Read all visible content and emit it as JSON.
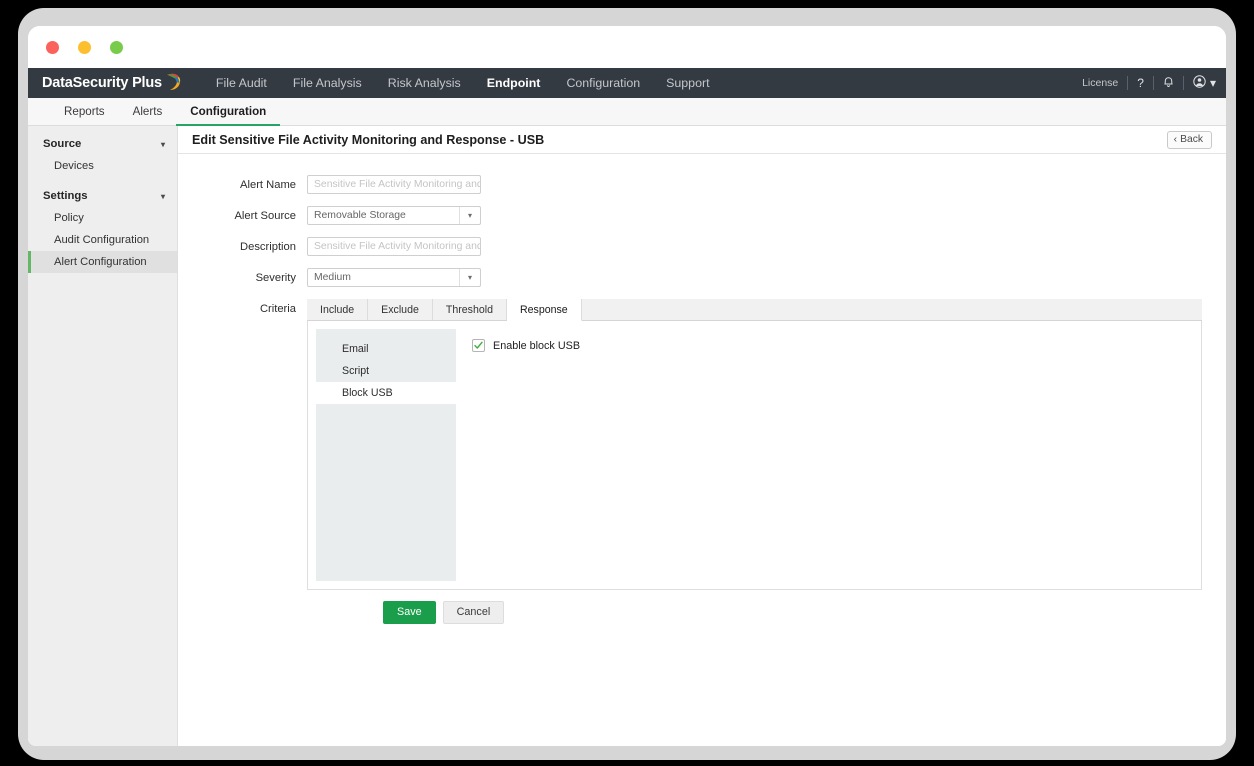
{
  "window": {
    "traffic_lights": [
      "close",
      "minimize",
      "maximize"
    ]
  },
  "topnav": {
    "brand": "DataSecurity Plus",
    "items": [
      {
        "label": "File Audit",
        "active": false
      },
      {
        "label": "File Analysis",
        "active": false
      },
      {
        "label": "Risk Analysis",
        "active": false
      },
      {
        "label": "Endpoint",
        "active": true
      },
      {
        "label": "Configuration",
        "active": false
      },
      {
        "label": "Support",
        "active": false
      }
    ],
    "right": {
      "license": "License",
      "help": "?",
      "notifications_icon": "bell-icon",
      "account_icon": "user-circle-icon",
      "account_caret": "▾"
    }
  },
  "subnav": {
    "items": [
      {
        "label": "Reports",
        "active": false
      },
      {
        "label": "Alerts",
        "active": false
      },
      {
        "label": "Configuration",
        "active": true
      }
    ]
  },
  "sidebar": {
    "groups": [
      {
        "label": "Source",
        "caret": "▾",
        "items": [
          {
            "label": "Devices",
            "selected": false
          }
        ]
      },
      {
        "label": "Settings",
        "caret": "▾",
        "items": [
          {
            "label": "Policy",
            "selected": false
          },
          {
            "label": "Audit Configuration",
            "selected": false
          },
          {
            "label": "Alert Configuration",
            "selected": true
          }
        ]
      }
    ]
  },
  "page": {
    "title": "Edit Sensitive File Activity Monitoring and Response - USB",
    "back_label": "Back",
    "back_icon": "chevron-left-icon"
  },
  "form": {
    "alert_name": {
      "label": "Alert Name",
      "value": "Sensitive File Activity Monitoring and Resp",
      "placeholder": "Sensitive File Activity Monitoring and Resp"
    },
    "alert_source": {
      "label": "Alert Source",
      "value": "Removable Storage",
      "options": [
        "Removable Storage"
      ],
      "caret_icon": "chevron-down-icon"
    },
    "description": {
      "label": "Description",
      "value": "Sensitive File Activity Monitoring and Resp",
      "placeholder": "Sensitive File Activity Monitoring and Resp"
    },
    "severity": {
      "label": "Severity",
      "value": "Medium",
      "options": [
        "Medium"
      ],
      "caret_icon": "chevron-down-icon"
    },
    "criteria": {
      "label": "Criteria",
      "tabs": [
        {
          "label": "Include",
          "active": false
        },
        {
          "label": "Exclude",
          "active": false
        },
        {
          "label": "Threshold",
          "active": false
        },
        {
          "label": "Response",
          "active": true
        }
      ]
    }
  },
  "response_panel": {
    "list": [
      {
        "label": "Email",
        "selected": false
      },
      {
        "label": "Script",
        "selected": false
      },
      {
        "label": "Block USB",
        "selected": true
      }
    ],
    "checkbox": {
      "label": "Enable block USB",
      "checked": true,
      "check_icon": "check-icon"
    }
  },
  "actions": {
    "save": "Save",
    "cancel": "Cancel"
  },
  "colors": {
    "nav_bg": "#343a42",
    "accent_green": "#27a567",
    "save_green": "#1b9e4b",
    "sidebar_bg": "#eeeeee",
    "selected_item_bg": "#e0e0e0",
    "selected_item_bar": "#62b865",
    "list_panel_bg": "#e9edee",
    "traffic_red": "#fb625c",
    "traffic_yellow": "#fcc02e",
    "traffic_green": "#79cc4b"
  }
}
